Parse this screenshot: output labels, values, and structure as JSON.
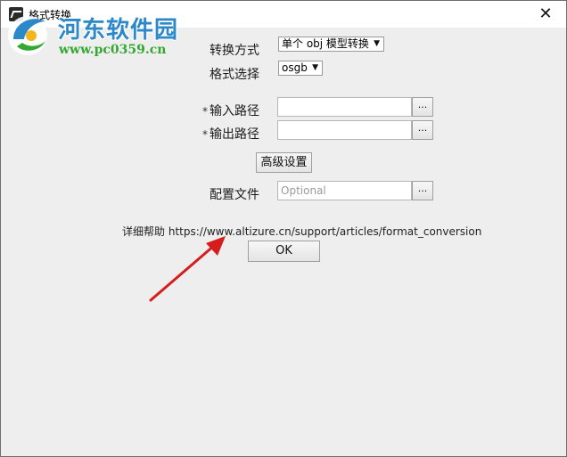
{
  "window": {
    "title": "格式转换",
    "close_glyph": "✕"
  },
  "watermark": {
    "site_name": "河东软件园",
    "site_url": "www.pc0359.cn"
  },
  "form": {
    "conversion_mode": {
      "label": "转换方式",
      "value": "单个 obj 模型转换"
    },
    "format_select": {
      "label": "格式选择",
      "value": "osgb"
    },
    "input_path": {
      "required_mark": "*",
      "label": "输入路径",
      "value": "",
      "browse_label": "..."
    },
    "output_path": {
      "required_mark": "*",
      "label": "输出路径",
      "value": "",
      "browse_label": "..."
    },
    "advanced_button": "高级设置",
    "config_file": {
      "label": "配置文件",
      "placeholder": "Optional",
      "browse_label": "..."
    },
    "help": {
      "label": "详细帮助",
      "url": "https://www.altizure.cn/support/articles/format_conversion"
    },
    "ok_button": "OK"
  },
  "colors": {
    "window_bg": "#eeeeee",
    "watermark_blue": "#2c88c9",
    "watermark_green": "#33a832",
    "annotation_arrow": "#d51d1d"
  },
  "icons": {
    "app": "app-logo-icon",
    "close": "close-icon",
    "dropdown": "chevron-down-icon",
    "annotation": "red-arrow-icon"
  }
}
